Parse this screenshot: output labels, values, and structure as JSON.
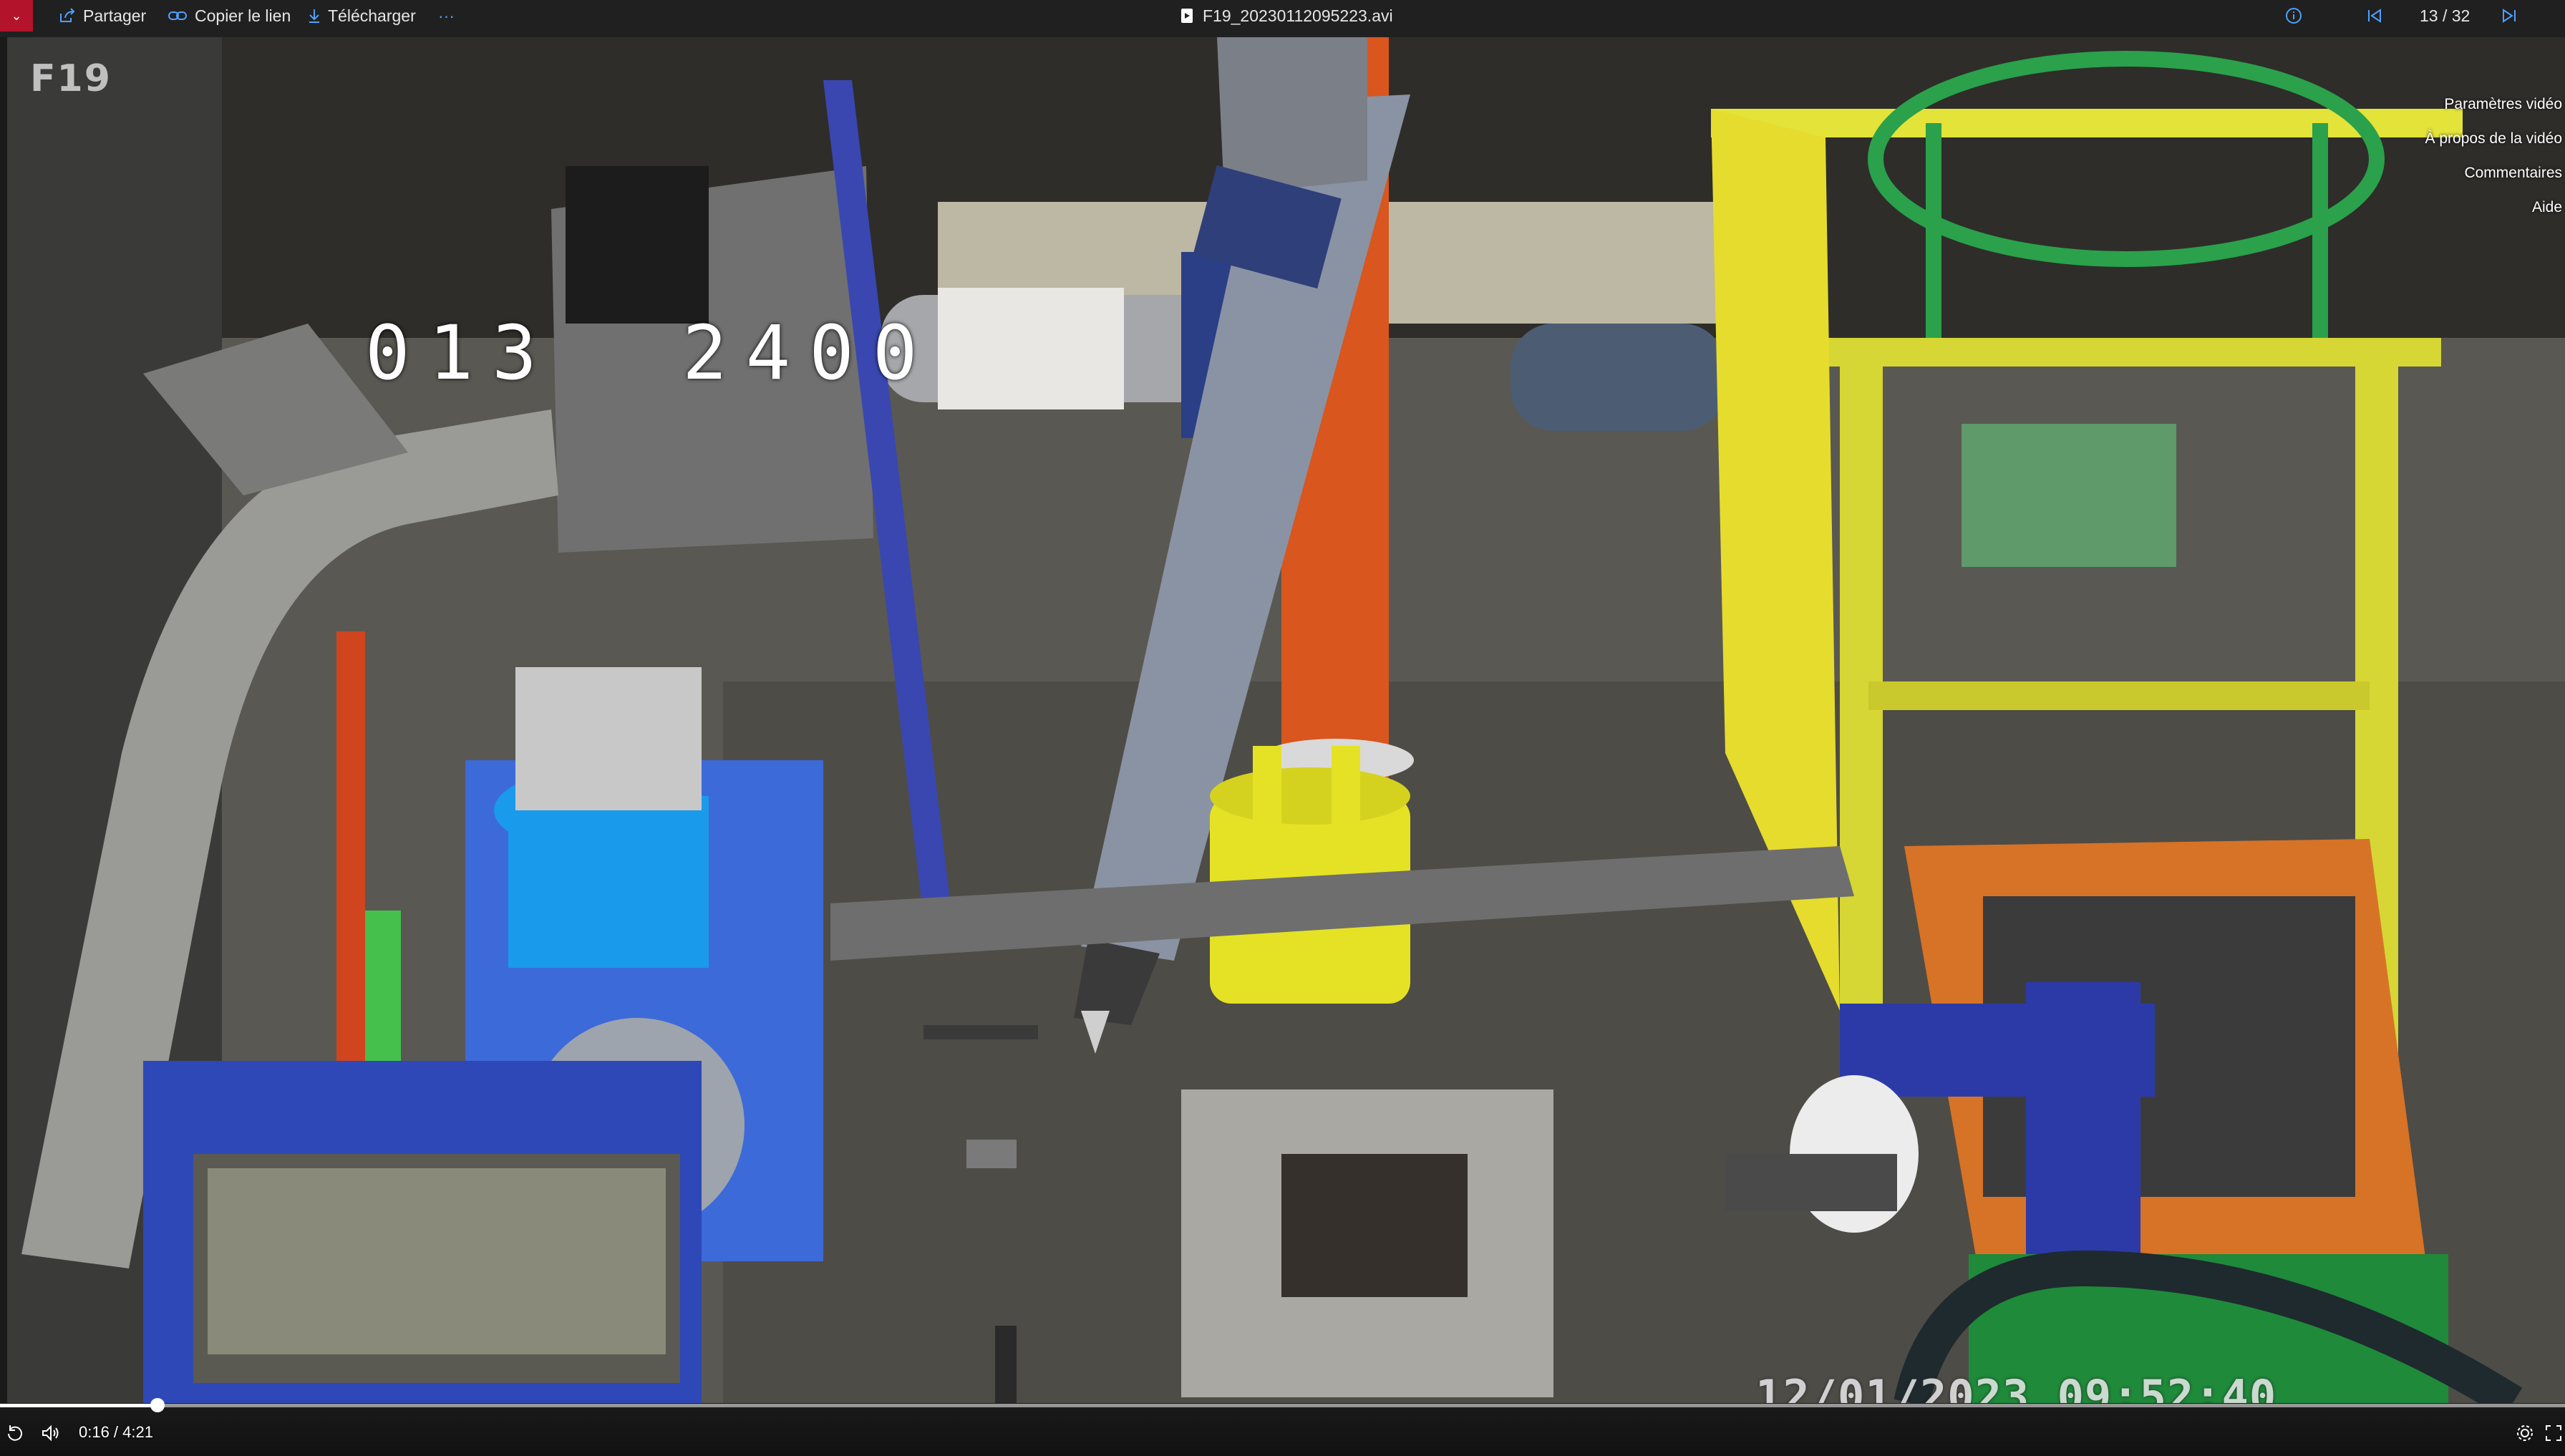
{
  "toolbar": {
    "share_label": "Partager",
    "copy_link_label": "Copier le lien",
    "download_label": "Télécharger",
    "more_label": "···",
    "file_name": "F19_20230112095223.avi",
    "counter": "13 / 32"
  },
  "video": {
    "camera_label": "F19",
    "osd_counter": "013  2400",
    "osd_timestamp": "12/01/2023 09:52:40"
  },
  "side_menu": {
    "items": [
      "Paramètres vidéo",
      "À propos de la vidéo",
      "Commentaires",
      "Aide"
    ]
  },
  "player": {
    "current_time": "0:16",
    "duration": "4:21",
    "time_display": "0:16 / 4:21",
    "progress": 0.0613
  },
  "colors": {
    "toolbar_bg": "#202020",
    "accent_red": "#b3132b",
    "accent_blue": "#4ea1ff"
  }
}
